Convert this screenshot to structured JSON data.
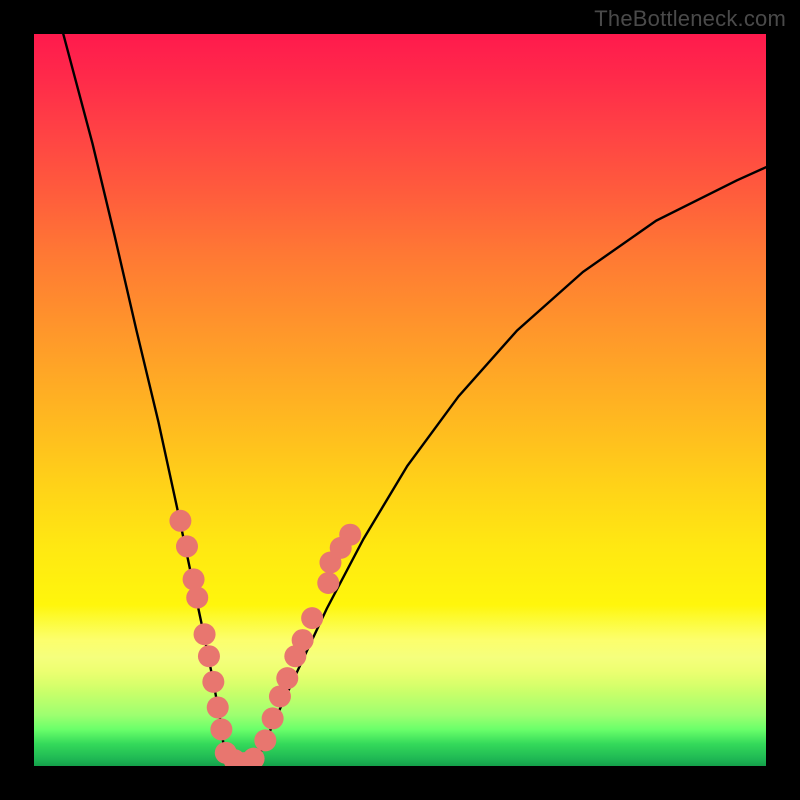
{
  "watermark": "TheBottleneck.com",
  "chart_data": {
    "type": "line",
    "title": "",
    "xlabel": "",
    "ylabel": "",
    "xlim": [
      0,
      1
    ],
    "ylim": [
      0,
      1
    ],
    "notes": "V-shaped bottleneck curve over red-to-green vertical gradient. Axes unlabeled; values normalized 0..1 (x horizontal, y vertical with 0 at top). Pink marker clusters overlay the curve in the lower-yellow band on both arms.",
    "series": [
      {
        "name": "curve-left",
        "x": [
          0.04,
          0.08,
          0.11,
          0.14,
          0.17,
          0.195,
          0.215,
          0.232,
          0.245,
          0.255,
          0.26
        ],
        "y": [
          0.0,
          0.15,
          0.275,
          0.405,
          0.53,
          0.645,
          0.74,
          0.82,
          0.885,
          0.94,
          0.98
        ]
      },
      {
        "name": "curve-bottom",
        "x": [
          0.26,
          0.27,
          0.282,
          0.296,
          0.31
        ],
        "y": [
          0.98,
          0.992,
          0.996,
          0.992,
          0.98
        ]
      },
      {
        "name": "curve-right",
        "x": [
          0.31,
          0.33,
          0.36,
          0.4,
          0.45,
          0.51,
          0.58,
          0.66,
          0.75,
          0.85,
          0.96,
          1.0
        ],
        "y": [
          0.98,
          0.935,
          0.87,
          0.785,
          0.69,
          0.59,
          0.495,
          0.405,
          0.325,
          0.255,
          0.2,
          0.182
        ]
      }
    ],
    "markers": {
      "color": "#e8766f",
      "radius_px": 11,
      "left_arm": [
        {
          "x": 0.2,
          "y": 0.665
        },
        {
          "x": 0.209,
          "y": 0.7
        },
        {
          "x": 0.218,
          "y": 0.745
        },
        {
          "x": 0.223,
          "y": 0.77
        },
        {
          "x": 0.233,
          "y": 0.82
        },
        {
          "x": 0.239,
          "y": 0.85
        },
        {
          "x": 0.245,
          "y": 0.885
        },
        {
          "x": 0.251,
          "y": 0.92
        },
        {
          "x": 0.256,
          "y": 0.95
        }
      ],
      "right_arm": [
        {
          "x": 0.316,
          "y": 0.965
        },
        {
          "x": 0.326,
          "y": 0.935
        },
        {
          "x": 0.336,
          "y": 0.905
        },
        {
          "x": 0.346,
          "y": 0.88
        },
        {
          "x": 0.357,
          "y": 0.85
        },
        {
          "x": 0.367,
          "y": 0.828
        },
        {
          "x": 0.38,
          "y": 0.798
        },
        {
          "x": 0.402,
          "y": 0.75
        },
        {
          "x": 0.405,
          "y": 0.722
        },
        {
          "x": 0.419,
          "y": 0.702
        },
        {
          "x": 0.432,
          "y": 0.684
        }
      ],
      "bottom": [
        {
          "x": 0.262,
          "y": 0.982
        },
        {
          "x": 0.274,
          "y": 0.992
        },
        {
          "x": 0.287,
          "y": 0.996
        },
        {
          "x": 0.3,
          "y": 0.99
        }
      ]
    }
  }
}
